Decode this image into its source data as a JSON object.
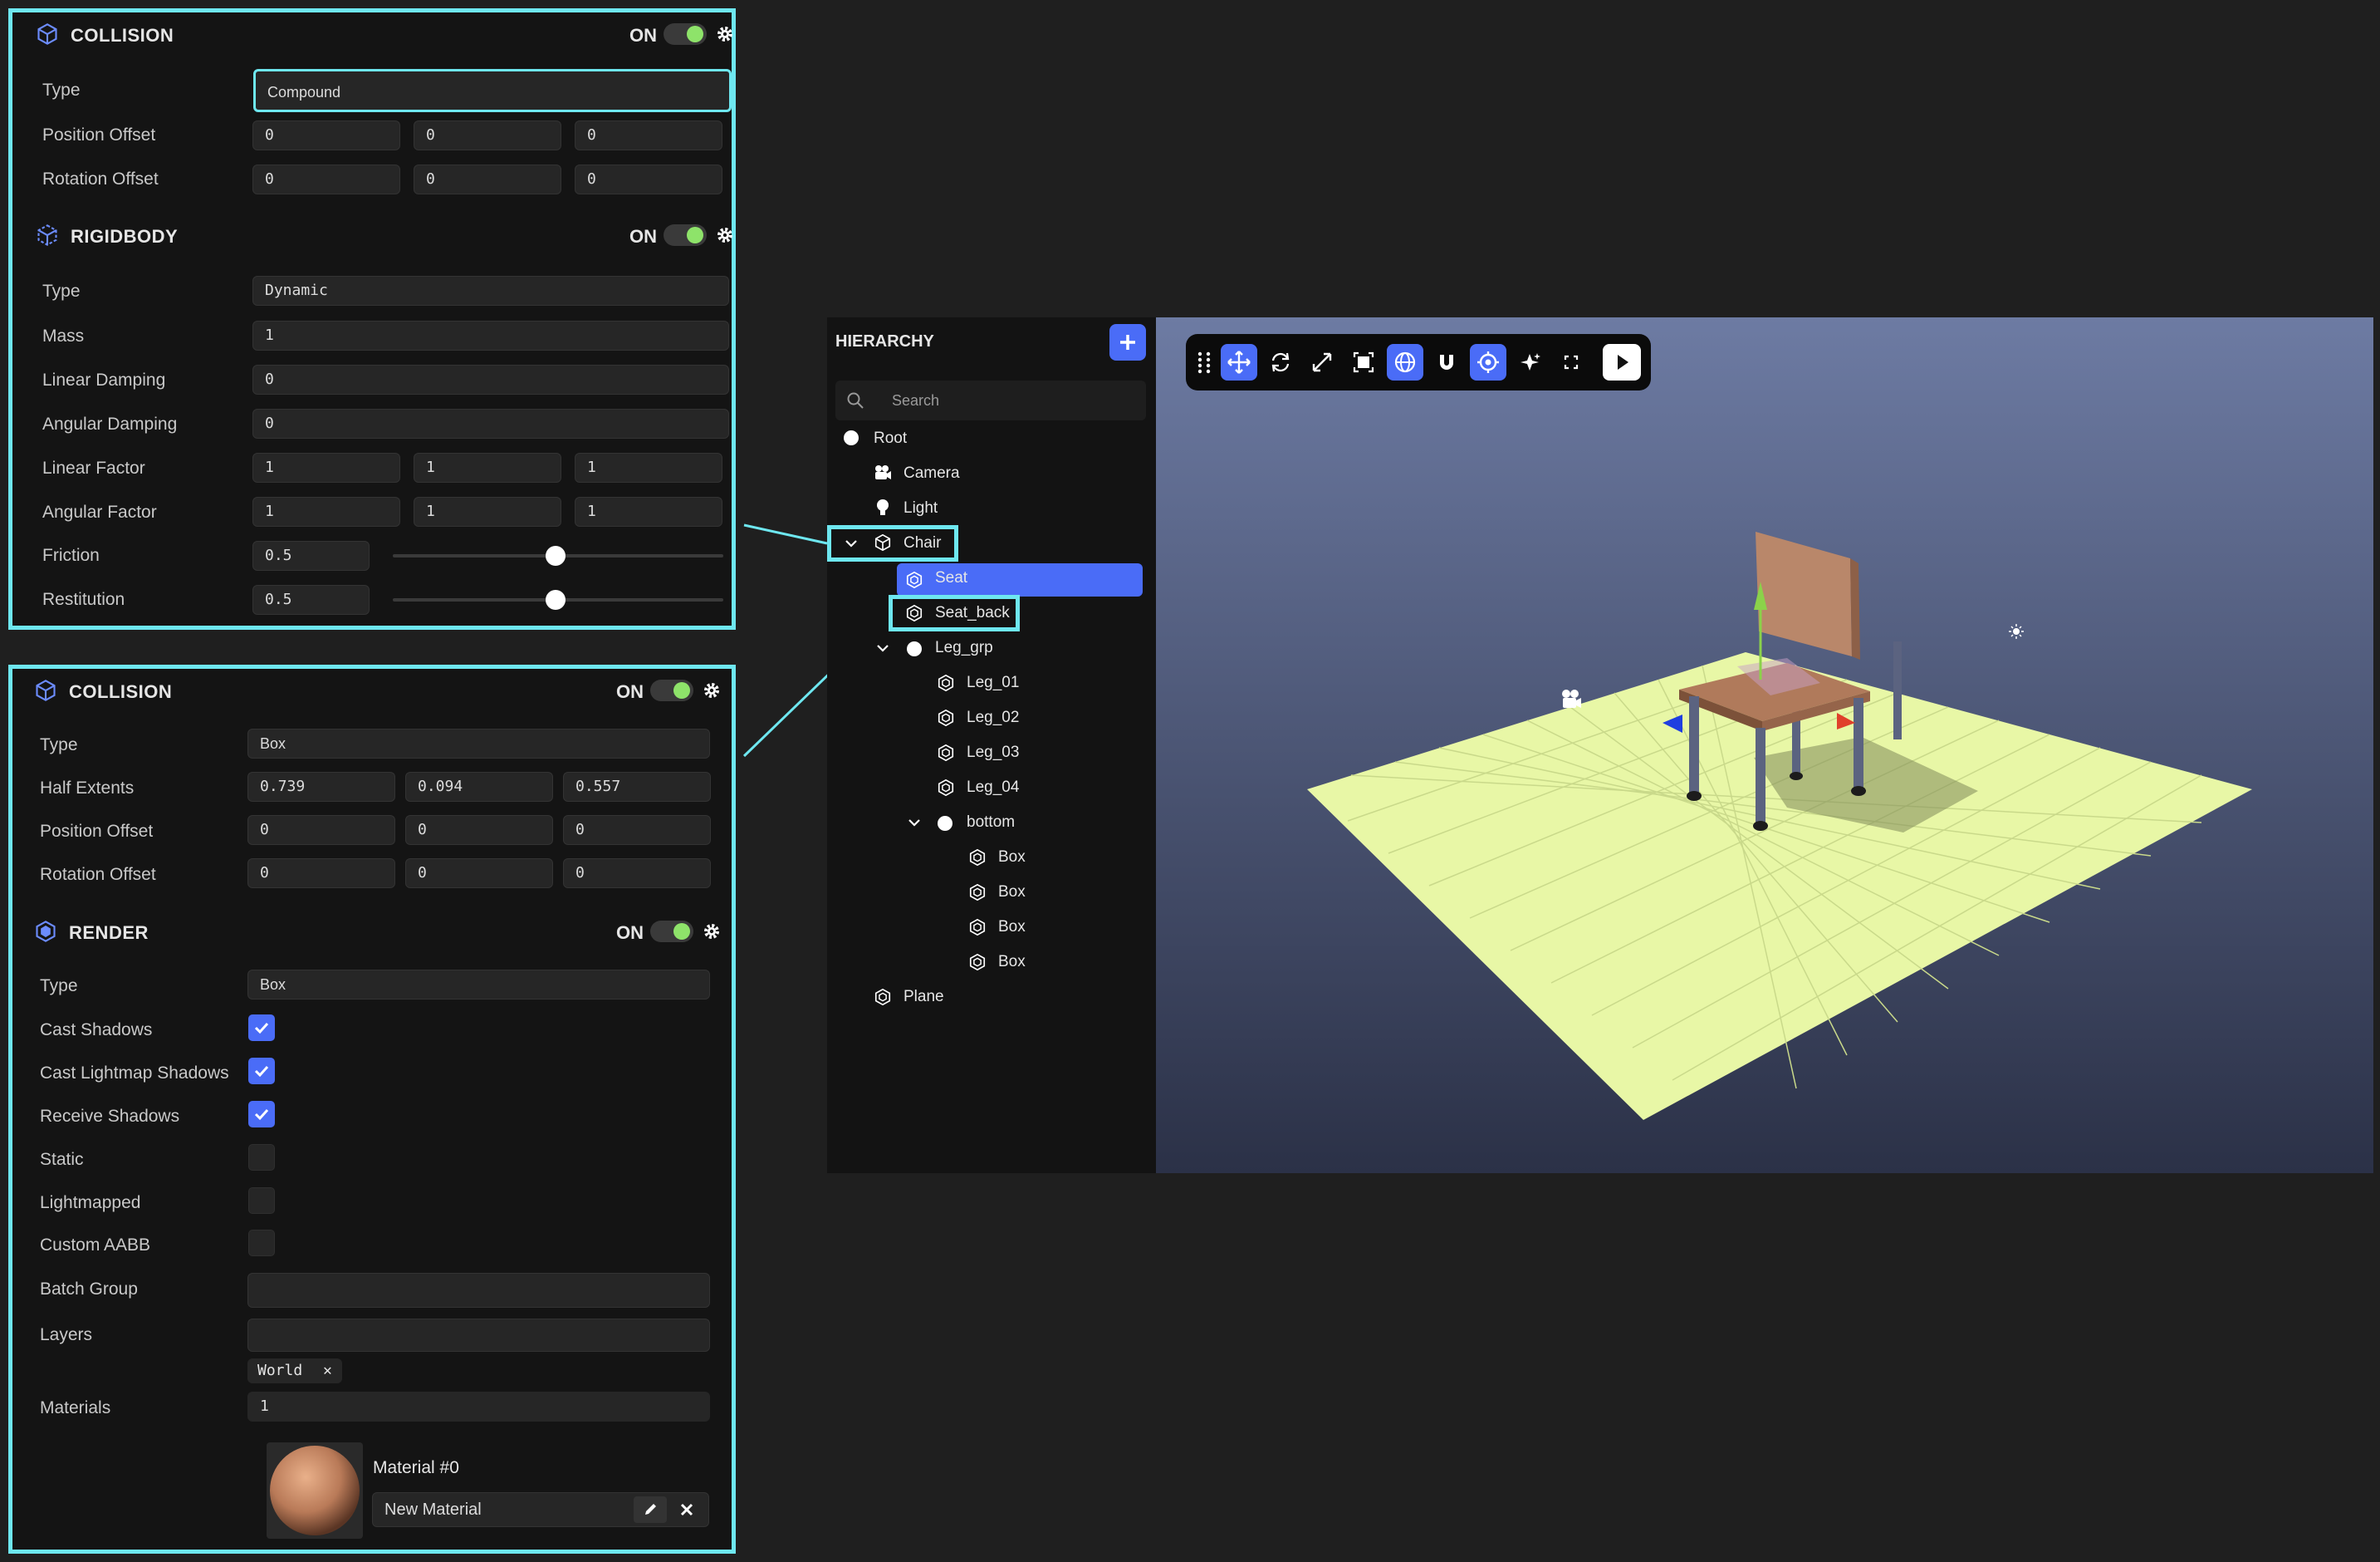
{
  "colors": {
    "accent": "#4a6cf7",
    "highlight": "#6ee7f0",
    "toggle_on": "#8ee36a",
    "ground": "#e8f7a6"
  },
  "insp_top": {
    "collision": {
      "title": "COLLISION",
      "on": "ON",
      "type_label": "Type",
      "type_value": "Compound",
      "pos_label": "Position Offset",
      "pos": [
        "0",
        "0",
        "0"
      ],
      "rot_label": "Rotation Offset",
      "rot": [
        "0",
        "0",
        "0"
      ]
    },
    "rigidbody": {
      "title": "RIGIDBODY",
      "on": "ON",
      "type_label": "Type",
      "type_value": "Dynamic",
      "mass_label": "Mass",
      "mass": "1",
      "lin_damp_label": "Linear Damping",
      "lin_damp": "0",
      "ang_damp_label": "Angular Damping",
      "ang_damp": "0",
      "lin_factor_label": "Linear Factor",
      "lin_factor": [
        "1",
        "1",
        "1"
      ],
      "ang_factor_label": "Angular Factor",
      "ang_factor": [
        "1",
        "1",
        "1"
      ],
      "friction_label": "Friction",
      "friction": "0.5",
      "restitution_label": "Restitution",
      "restitution": "0.5"
    }
  },
  "insp_bottom": {
    "collision": {
      "title": "COLLISION",
      "on": "ON",
      "type_label": "Type",
      "type_value": "Box",
      "half_label": "Half Extents",
      "half": [
        "0.739",
        "0.094",
        "0.557"
      ],
      "pos_label": "Position Offset",
      "pos": [
        "0",
        "0",
        "0"
      ],
      "rot_label": "Rotation Offset",
      "rot": [
        "0",
        "0",
        "0"
      ]
    },
    "render": {
      "title": "RENDER",
      "on": "ON",
      "type_label": "Type",
      "type_value": "Box",
      "cast_shadows": "Cast Shadows",
      "cast_lightmap": "Cast Lightmap Shadows",
      "receive_shadows": "Receive Shadows",
      "static": "Static",
      "lightmapped": "Lightmapped",
      "custom_aabb": "Custom AABB",
      "batch_group": "Batch Group",
      "layers": "Layers",
      "layer_chip": "World",
      "materials_label": "Materials",
      "materials_count": "1",
      "material_name": "Material #0",
      "material_value": "New Material"
    }
  },
  "hierarchy": {
    "title": "HIERARCHY",
    "search_placeholder": "Search",
    "items": {
      "root": "Root",
      "camera": "Camera",
      "light": "Light",
      "chair": "Chair",
      "seat": "Seat",
      "seat_back": "Seat_back",
      "leg_grp": "Leg_grp",
      "leg01": "Leg_01",
      "leg02": "Leg_02",
      "leg03": "Leg_03",
      "leg04": "Leg_04",
      "bottom": "bottom",
      "box1": "Box",
      "box2": "Box",
      "box3": "Box",
      "box4": "Box",
      "plane": "Plane"
    }
  }
}
